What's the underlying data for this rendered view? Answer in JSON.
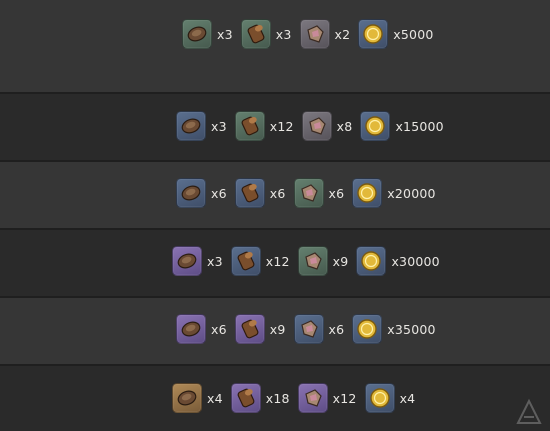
{
  "rows": [
    {
      "items": [
        {
          "icon": "coin-ore-icon",
          "rarity": "green",
          "qty": "x3"
        },
        {
          "icon": "log-icon",
          "rarity": "green",
          "qty": "x3"
        },
        {
          "icon": "fragment-icon",
          "rarity": "gray",
          "qty": "x2"
        },
        {
          "icon": "mora-coin-icon",
          "rarity": "blue",
          "qty": "x5000"
        }
      ]
    },
    {
      "items": [
        {
          "icon": "coin-ore-icon",
          "rarity": "blue",
          "qty": "x3"
        },
        {
          "icon": "log-icon",
          "rarity": "green",
          "qty": "x12"
        },
        {
          "icon": "fragment-icon",
          "rarity": "gray",
          "qty": "x8"
        },
        {
          "icon": "mora-coin-icon",
          "rarity": "blue",
          "qty": "x15000"
        }
      ]
    },
    {
      "items": [
        {
          "icon": "coin-ore-icon",
          "rarity": "blue",
          "qty": "x6"
        },
        {
          "icon": "log-icon",
          "rarity": "blue",
          "qty": "x6"
        },
        {
          "icon": "fragment-icon",
          "rarity": "green",
          "qty": "x6"
        },
        {
          "icon": "mora-coin-icon",
          "rarity": "blue",
          "qty": "x20000"
        }
      ]
    },
    {
      "items": [
        {
          "icon": "coin-ore-icon",
          "rarity": "purple",
          "qty": "x3"
        },
        {
          "icon": "log-icon",
          "rarity": "blue",
          "qty": "x12"
        },
        {
          "icon": "fragment-icon",
          "rarity": "green",
          "qty": "x9"
        },
        {
          "icon": "mora-coin-icon",
          "rarity": "blue",
          "qty": "x30000"
        }
      ]
    },
    {
      "items": [
        {
          "icon": "coin-ore-icon",
          "rarity": "purple",
          "qty": "x6"
        },
        {
          "icon": "log-icon",
          "rarity": "purple",
          "qty": "x9"
        },
        {
          "icon": "fragment-icon",
          "rarity": "blue",
          "qty": "x6"
        },
        {
          "icon": "mora-coin-icon",
          "rarity": "blue",
          "qty": "x35000"
        }
      ]
    },
    {
      "items": [
        {
          "icon": "coin-ore-icon",
          "rarity": "gold",
          "qty": "x4"
        },
        {
          "icon": "log-icon",
          "rarity": "purple",
          "qty": "x18"
        },
        {
          "icon": "fragment-icon",
          "rarity": "purple",
          "qty": "x12"
        },
        {
          "icon": "mora-coin-icon",
          "rarity": "blue",
          "qty": "x4"
        }
      ]
    }
  ],
  "watermark": {
    "icon": "watermark-logo-icon"
  }
}
